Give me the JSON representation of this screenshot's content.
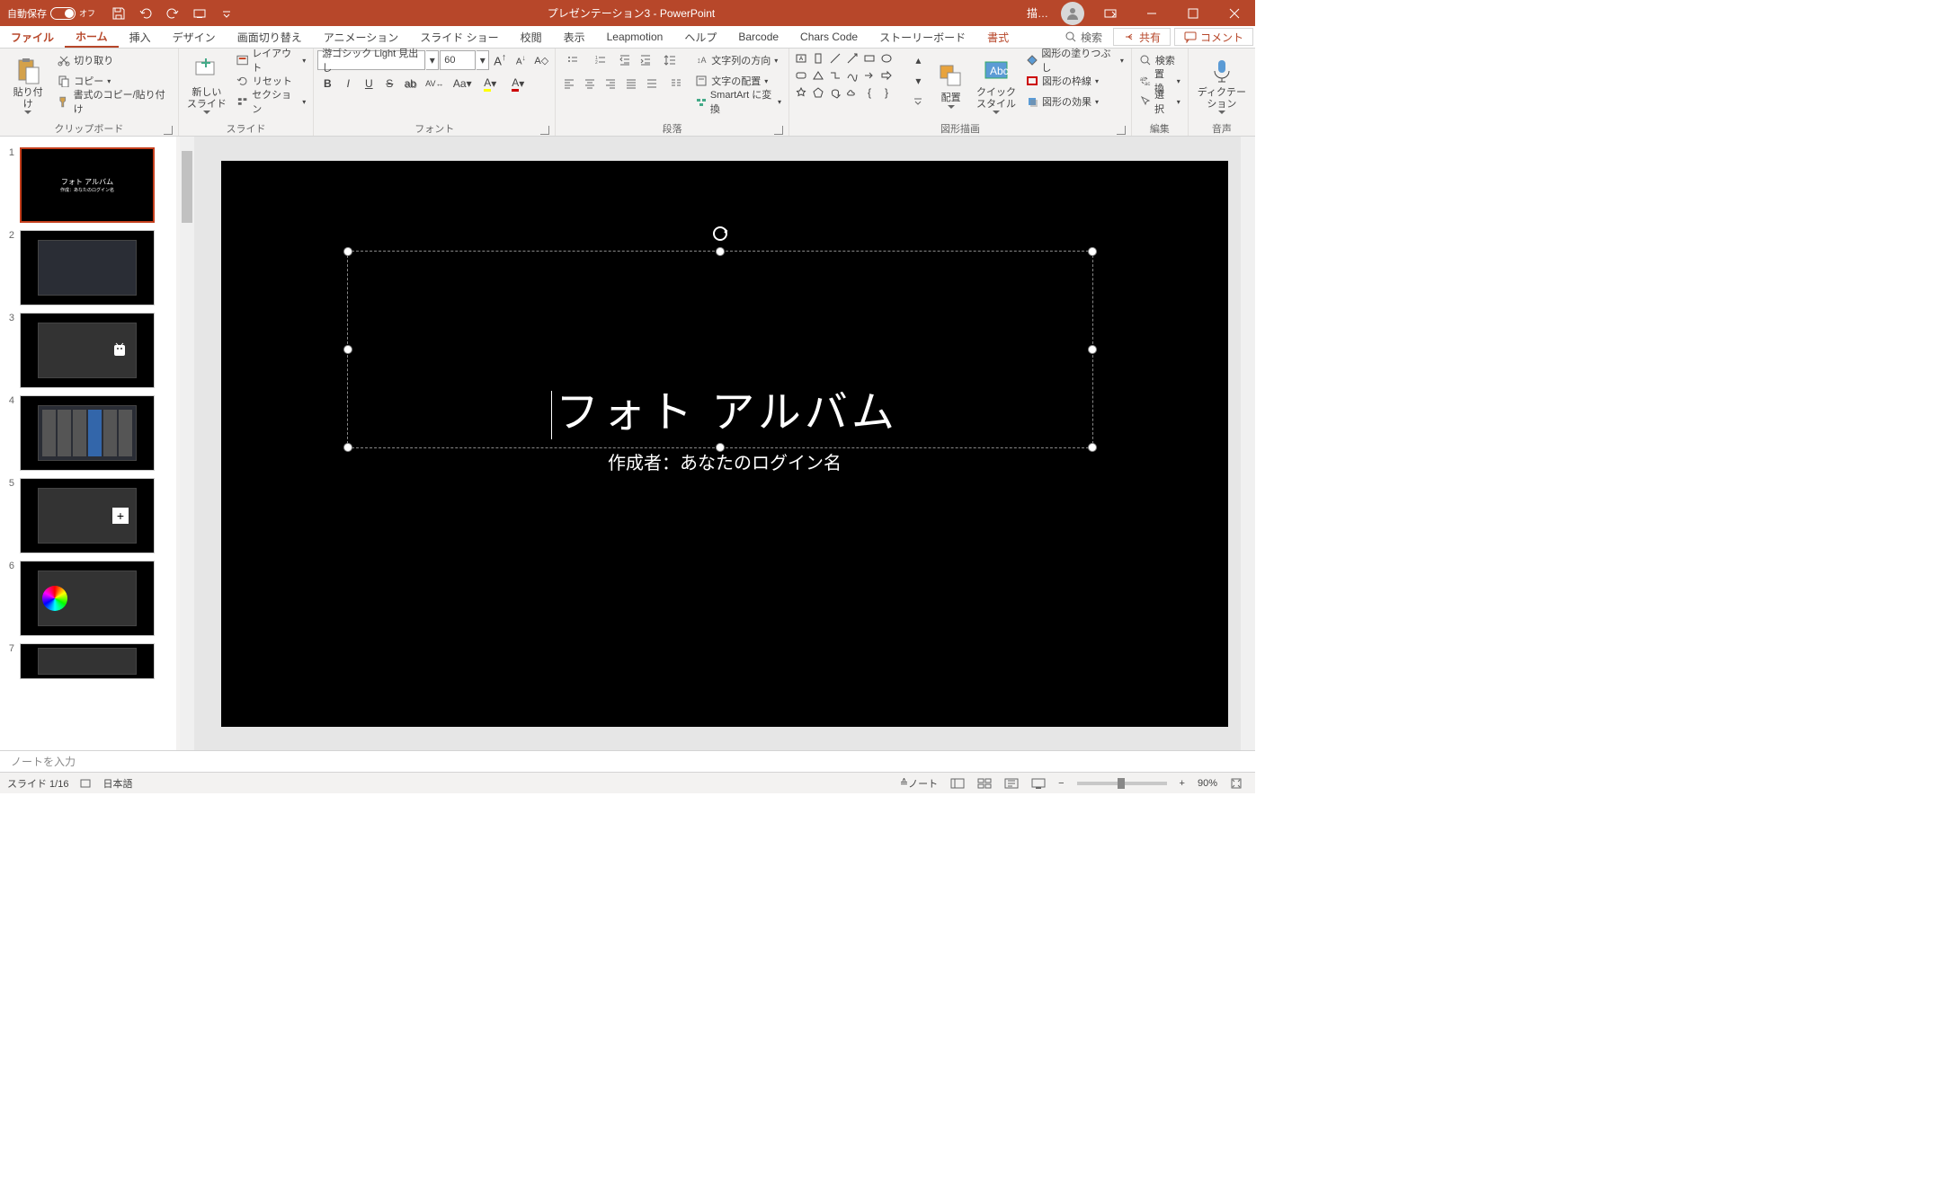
{
  "titlebar": {
    "autosave_label": "自動保存",
    "autosave_state": "オフ",
    "title": "プレゼンテーション3  -  PowerPoint",
    "draw_label": "描…"
  },
  "tabs": {
    "file": "ファイル",
    "home": "ホーム",
    "insert": "挿入",
    "design": "デザイン",
    "transitions": "画面切り替え",
    "animations": "アニメーション",
    "slideshow": "スライド ショー",
    "review": "校閲",
    "view": "表示",
    "leapmotion": "Leapmotion",
    "help": "ヘルプ",
    "barcode": "Barcode",
    "charscode": "Chars Code",
    "storyboard": "ストーリーボード",
    "format": "書式",
    "search": "検索",
    "share": "共有",
    "comments": "コメント"
  },
  "ribbon": {
    "clipboard": {
      "paste": "貼り付け",
      "cut": "切り取り",
      "copy": "コピー",
      "formatpainter": "書式のコピー/貼り付け",
      "label": "クリップボード"
    },
    "slides": {
      "newslide": "新しい\nスライド",
      "layout": "レイアウト",
      "reset": "リセット",
      "section": "セクション",
      "label": "スライド"
    },
    "font": {
      "name": "游ゴシック Light 見出し",
      "size": "60",
      "label": "フォント"
    },
    "paragraph": {
      "textdir": "文字列の方向",
      "align": "文字の配置",
      "smartart": "SmartArt に変換",
      "label": "段落"
    },
    "drawing": {
      "arrange": "配置",
      "quickstyles": "クイック\nスタイル",
      "fill": "図形の塗りつぶし",
      "outline": "図形の枠線",
      "effects": "図形の効果",
      "label": "図形描画"
    },
    "editing": {
      "find": "検索",
      "replace": "置換",
      "select": "選択",
      "label": "編集"
    },
    "voice": {
      "dictate": "ディクテー\nション",
      "label": "音声"
    }
  },
  "slide": {
    "title": "フォト アルバム",
    "subtitle": "作成者：あなたのログイン名"
  },
  "thumbs": {
    "slide1_title": "フォト アルバム",
    "slide1_sub": "作成：あなたのログイン名"
  },
  "notes": {
    "placeholder": "ノートを入力"
  },
  "status": {
    "slide": "スライド 1/16",
    "lang": "日本語",
    "notes_btn": "ノート",
    "zoom": "90%"
  }
}
